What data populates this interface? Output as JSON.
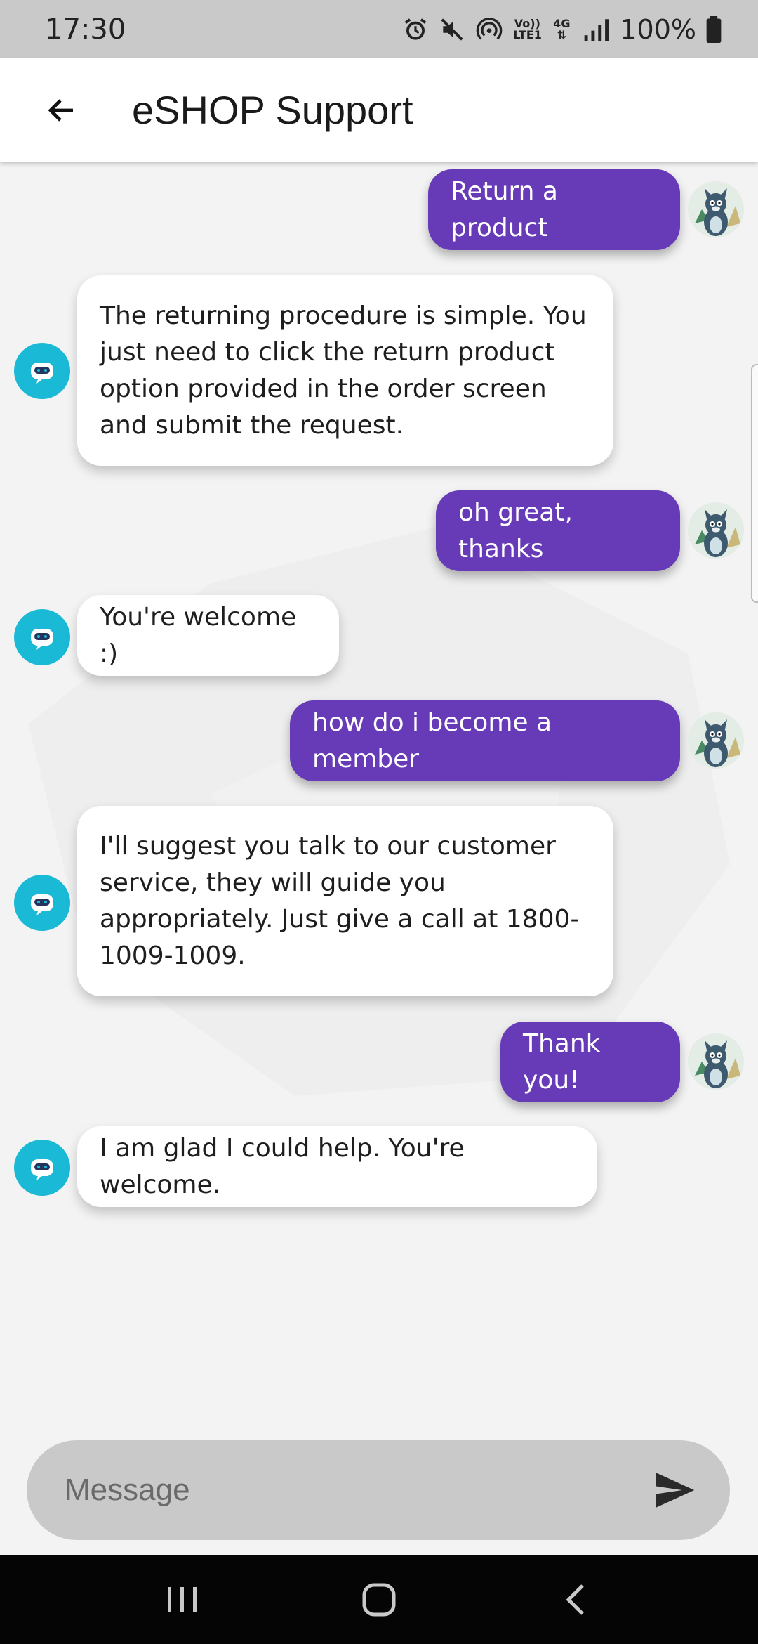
{
  "status_bar": {
    "time": "17:30",
    "volte_label": "Vo)) LTE1",
    "network_label": "4G",
    "battery": "100%",
    "icons": [
      "alarm-icon",
      "mute-icon",
      "hotspot-icon",
      "volte-icon",
      "data-icon",
      "signal-icon",
      "battery-icon"
    ]
  },
  "app_bar": {
    "title": "eSHOP Support",
    "back_icon": "arrow-left-icon"
  },
  "messages": [
    {
      "sender": "user",
      "text": "Return a product"
    },
    {
      "sender": "bot",
      "text": "The returning procedure is simple. You just need to click the return product option provided in the order screen and submit the request."
    },
    {
      "sender": "user",
      "text": "oh great, thanks"
    },
    {
      "sender": "bot",
      "text": "You're welcome :)"
    },
    {
      "sender": "user",
      "text": "how do i become a member"
    },
    {
      "sender": "bot",
      "text": "I'll suggest you talk to our customer service, they will guide you appropriately. Just give a call at 1800-1009-1009."
    },
    {
      "sender": "user",
      "text": "Thank you!"
    },
    {
      "sender": "bot",
      "text": "I am glad I could help. You're welcome."
    }
  ],
  "input": {
    "placeholder": "Message",
    "value": "",
    "send_icon": "send-icon"
  },
  "nav_bar": {
    "icons": [
      "recent-apps-icon",
      "home-icon",
      "back-icon"
    ]
  },
  "colors": {
    "accent": "#673ab7",
    "bot_avatar": "#1ab9d6",
    "chat_background": "#f3f3f3",
    "input_background": "#c9c9c9"
  }
}
